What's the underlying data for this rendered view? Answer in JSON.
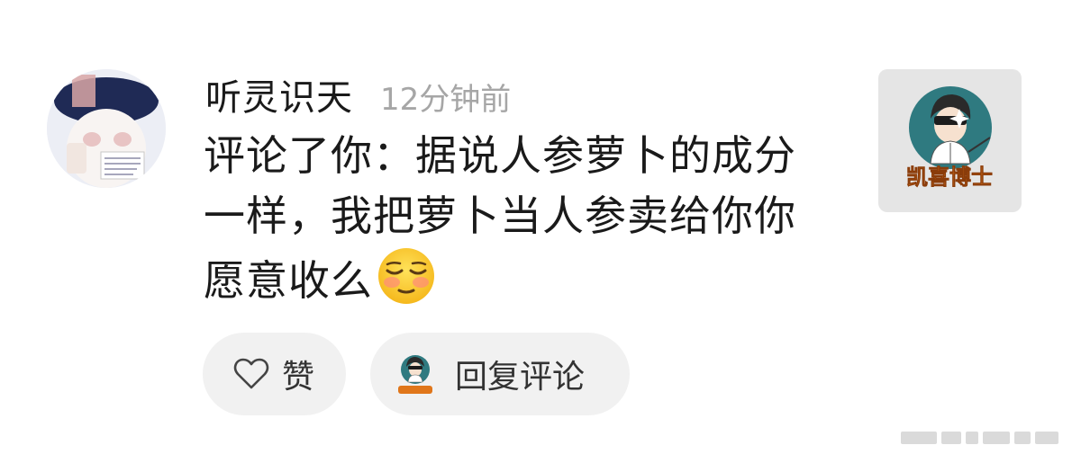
{
  "comment": {
    "username": "听灵识天",
    "time": "12分钟前",
    "text": "评论了你：据说人参萝卜的成分一样，我把萝卜当人参卖给你你愿意收么",
    "emoji": "relieved-face-emoji",
    "thumbnail_label": "凯喜博士"
  },
  "actions": {
    "like_label": "赞",
    "reply_label": "回复评论",
    "like_icon": "heart-outline-icon"
  },
  "colors": {
    "background": "#ffffff",
    "button_bg": "#f1f1f1",
    "time_text": "#a6a6a6",
    "thumbnail_bg": "#e5e5e5",
    "logo_orange": "#e0761a",
    "logo_teal": "#2f7a80"
  }
}
